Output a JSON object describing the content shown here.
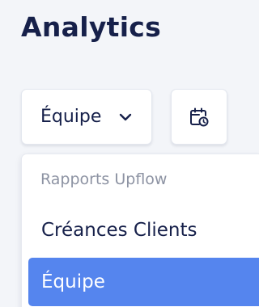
{
  "page": {
    "title": "Analytics"
  },
  "toolbar": {
    "team_selector": {
      "selected": "Équipe",
      "icon": "chevron-down-icon"
    },
    "date_button": {
      "icon": "calendar-clock-icon"
    }
  },
  "dropdown": {
    "group_label": "Rapports Upflow",
    "options": [
      {
        "label": "Créances Clients",
        "selected": false
      },
      {
        "label": "Équipe",
        "selected": true
      }
    ]
  },
  "colors": {
    "background": "#f3f5f9",
    "title_text": "#16204a",
    "selected_option_bg": "#5585ee",
    "group_label_text": "#8d93a3"
  }
}
